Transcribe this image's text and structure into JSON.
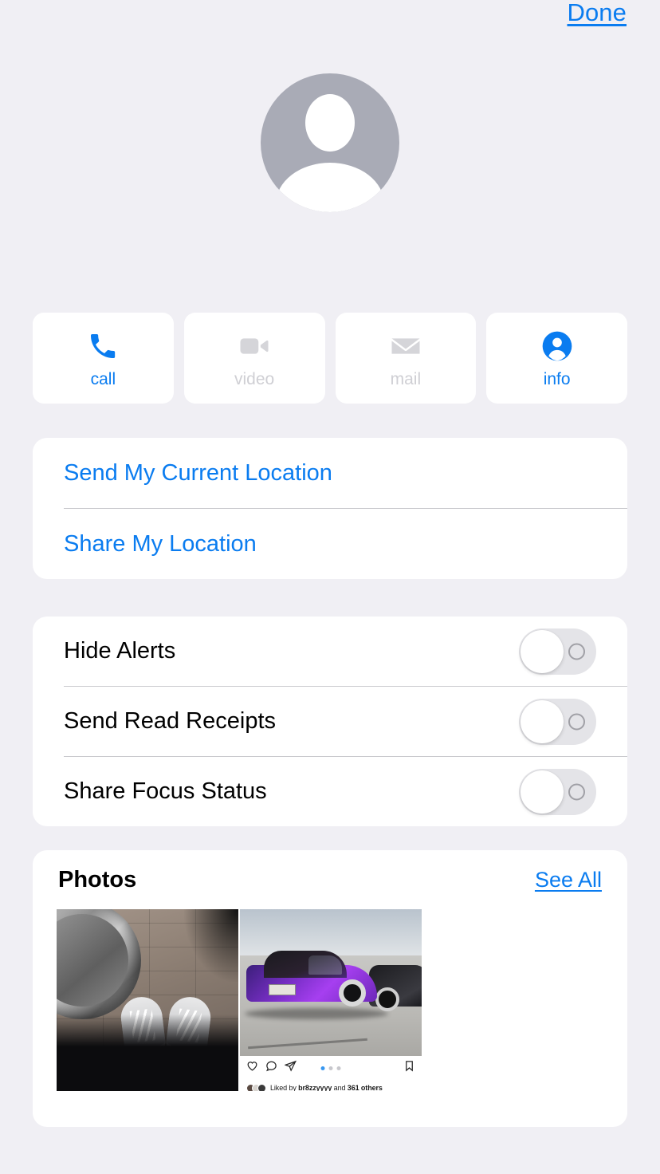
{
  "topbar": {
    "done_label": "Done"
  },
  "avatar": {
    "icon": "person-placeholder-icon",
    "contact_name": ""
  },
  "actions": [
    {
      "label": "call",
      "icon": "phone-icon",
      "enabled": true
    },
    {
      "label": "video",
      "icon": "video-camera-icon",
      "enabled": false
    },
    {
      "label": "mail",
      "icon": "envelope-icon",
      "enabled": false
    },
    {
      "label": "info",
      "icon": "person-circle-icon",
      "enabled": true
    }
  ],
  "location": {
    "send_current": "Send My Current Location",
    "share": "Share My Location"
  },
  "settings": [
    {
      "label": "Hide Alerts",
      "value": "off"
    },
    {
      "label": "Send Read Receipts",
      "value": "off"
    },
    {
      "label": "Share Focus Status",
      "value": "off"
    }
  ],
  "photos": {
    "title": "Photos",
    "see_all": "See All",
    "items": [
      {
        "alt": "Overhead photo of white sneakers on brick pavement"
      },
      {
        "alt": "Purple stanced sports car on the beach"
      }
    ],
    "instagram": {
      "likes_text_prefix": "Liked by ",
      "likes_user": "br8zzyyyy",
      "likes_middle": " and ",
      "likes_count": "361 others",
      "icons": [
        "heart-icon",
        "comment-icon",
        "share-icon",
        "bookmark-icon"
      ],
      "carousel_dots": 3,
      "carousel_active": 0
    }
  },
  "colors": {
    "accent": "#0a7cf0",
    "background": "#f0eff4",
    "card": "#ffffff",
    "disabled": "#cfcfd4"
  }
}
